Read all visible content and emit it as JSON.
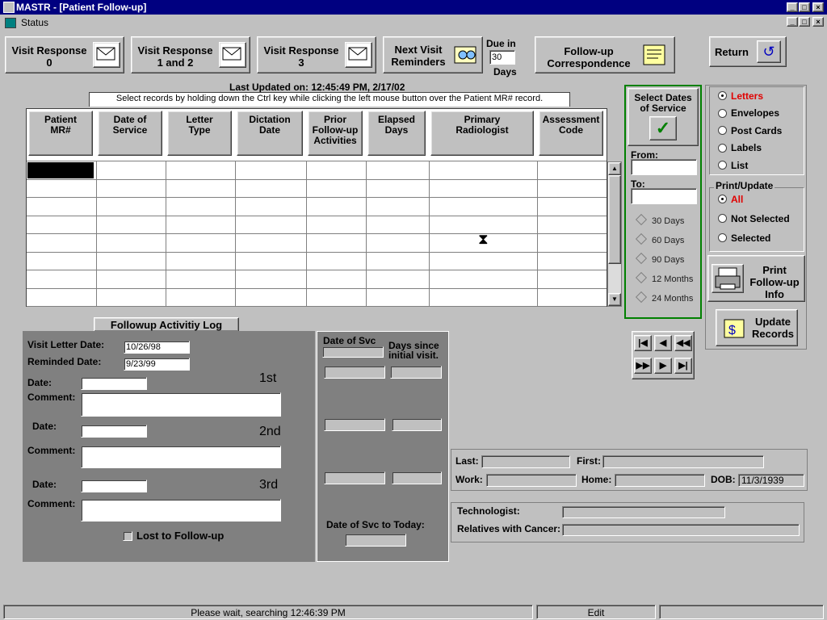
{
  "window": {
    "title": "MASTR - [Patient Follow-up]",
    "menu_status": "Status"
  },
  "toolbar": {
    "vr0_line1": "Visit Response",
    "vr0_line2": "0",
    "vr12_line1": "Visit Response",
    "vr12_line2": "1 and 2",
    "vr3_line1": "Visit Response",
    "vr3_line2": "3",
    "nvr_line1": "Next Visit",
    "nvr_line2": "Reminders",
    "due_in_label": "Due in",
    "due_in_value": "30",
    "due_in_unit": "Days",
    "fuc_line1": "Follow-up",
    "fuc_line2": "Correspondence",
    "return_label": "Return"
  },
  "grid": {
    "last_updated": "Last Updated on: 12:45:49 PM, 2/17/02",
    "instruction": "Select records by holding down the Ctrl key while  clicking the left mouse button over the Patient MR# record.",
    "headers": [
      [
        "Patient",
        "MR#",
        ""
      ],
      [
        "Date of",
        "Service",
        ""
      ],
      [
        "Letter",
        "Type",
        ""
      ],
      [
        "Dictation",
        "Date",
        ""
      ],
      [
        "Prior",
        "Follow-up",
        "Activities"
      ],
      [
        "Elapsed",
        "Days",
        ""
      ],
      [
        "Primary",
        "Radiologist",
        ""
      ],
      [
        "Assessment",
        "Code",
        ""
      ]
    ]
  },
  "dates": {
    "title_line1": "Select Dates",
    "title_line2": "of Service",
    "from_label": "From:",
    "to_label": "To:",
    "options": [
      "30 Days",
      "60 Days",
      "90 Days",
      "12 Months",
      "24 Months"
    ]
  },
  "output": {
    "options": [
      "Letters",
      "Envelopes",
      "Post Cards",
      "Labels",
      "List"
    ],
    "selected": "Letters"
  },
  "print_update": {
    "title": "Print/Update",
    "options": [
      "All",
      "Not Selected",
      "Selected"
    ],
    "selected": "All"
  },
  "print_btn": {
    "line1": "Print",
    "line2": "Follow-up",
    "line3": "Info"
  },
  "update_btn": {
    "line1": "Update",
    "line2": "Records"
  },
  "followup": {
    "tab": "Followup Activitiy Log",
    "visit_letter_label": "Visit Letter Date:",
    "visit_letter_value": "10/26/98",
    "reminded_label": "Reminded Date:",
    "reminded_value": "9/23/99",
    "date_label": "Date:",
    "comment_label": "Comment:",
    "first": "1st",
    "second": "2nd",
    "third": "3rd",
    "lost_label": "Lost to Follow-up"
  },
  "svc": {
    "date_of_svc": "Date of Svc",
    "days_since": "Days since initial visit.",
    "to_today": "Date of Svc to Today:"
  },
  "patient": {
    "last_label": "Last:",
    "first_label": "First:",
    "work_label": "Work:",
    "home_label": "Home:",
    "dob_label": "DOB:",
    "dob_value": "11/3/1939",
    "tech_label": "Technologist:",
    "relatives_label": "Relatives with Cancer:"
  },
  "statusbar": {
    "message": "Please wait, searching  12:46:39 PM",
    "mode": "Edit"
  }
}
